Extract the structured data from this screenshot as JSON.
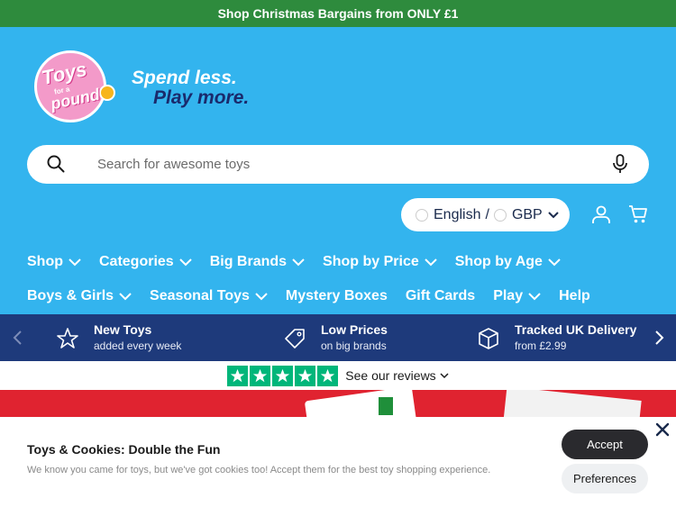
{
  "announcement": "Shop Christmas Bargains from ONLY £1",
  "logo": {
    "line1": "Toys",
    "small": "for a",
    "line2": "pound"
  },
  "tagline": {
    "line1": "Spend less.",
    "line2": "Play more."
  },
  "search": {
    "placeholder": "Search for awesome toys"
  },
  "locale": {
    "language": "English",
    "separator": "/",
    "currency": "GBP"
  },
  "nav": {
    "row1": [
      {
        "label": "Shop"
      },
      {
        "label": "Categories"
      },
      {
        "label": "Big Brands"
      },
      {
        "label": "Shop by Price"
      },
      {
        "label": "Shop by Age"
      }
    ],
    "row2": [
      {
        "label": "Boys & Girls"
      },
      {
        "label": "Seasonal Toys"
      },
      {
        "label": "Mystery Boxes"
      },
      {
        "label": "Gift Cards"
      },
      {
        "label": "Play"
      },
      {
        "label": "Help"
      }
    ]
  },
  "usp": [
    {
      "title": "New Toys",
      "subtitle": "added every week",
      "icon": "star-icon"
    },
    {
      "title": "Low Prices",
      "subtitle": "on big brands",
      "icon": "price-tag-icon"
    },
    {
      "title": "Tracked UK Delivery",
      "subtitle": "from £2.99",
      "icon": "box-icon"
    }
  ],
  "trustpilot": {
    "text": "See our reviews",
    "stars": 5
  },
  "cookie": {
    "title": "Toys & Cookies: Double the Fun",
    "text": "We know you came for toys, but we've got cookies too! Accept them for the best toy shopping experience.",
    "accept_label": "Accept",
    "preferences_label": "Preferences"
  },
  "colors": {
    "announcement_bg": "#2e8b3d",
    "header_bg": "#33b4ee",
    "usp_bg": "#1e3a7b",
    "trustpilot_green": "#00b67a",
    "hero_red": "#e02330"
  }
}
